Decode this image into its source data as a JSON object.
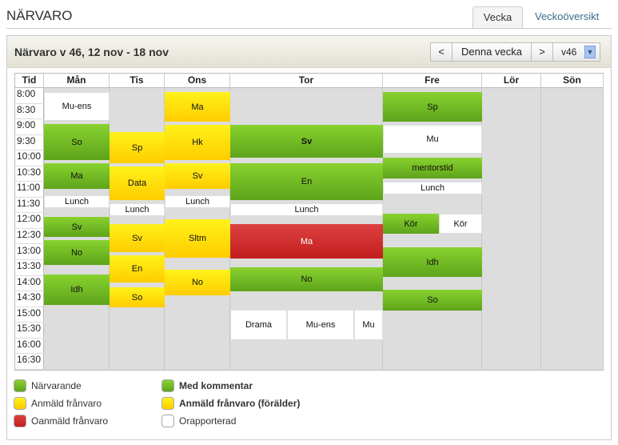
{
  "page": {
    "title": "NÄRVARO",
    "tabs": [
      "Vecka",
      "Veckoöversikt"
    ]
  },
  "panel": {
    "title": "Närvaro v 46, 12 nov - 18 nov",
    "prev": "<",
    "current": "Denna vecka",
    "next": ">",
    "week_select": "v46"
  },
  "colors": {
    "green": "#72bd24",
    "yellow": "#ffe010",
    "red": "#cc2a2a",
    "white": "#ffffff"
  },
  "grid": {
    "time_header": "Tid",
    "times": [
      "8:00",
      "8:30",
      "9:00",
      "9:30",
      "10:00",
      "10:30",
      "11:00",
      "11:30",
      "12:00",
      "12:30",
      "13:00",
      "13:30",
      "14:00",
      "14:30",
      "15:00",
      "15:30",
      "16:00",
      "16:30"
    ],
    "days": [
      {
        "name": "Mån",
        "events": [
          {
            "label": "Mu-ens",
            "status": "white"
          },
          {
            "label": "So",
            "status": "green"
          },
          {
            "label": "Ma",
            "status": "green"
          },
          {
            "label": "Lunch",
            "status": "white"
          },
          {
            "label": "Sv",
            "status": "green"
          },
          {
            "label": "No",
            "status": "green"
          },
          {
            "label": "Idh",
            "status": "green"
          }
        ]
      },
      {
        "name": "Tis",
        "events": [
          {
            "label": "Sp",
            "status": "yellow"
          },
          {
            "label": "Data",
            "status": "yellow"
          },
          {
            "label": "Lunch",
            "status": "white"
          },
          {
            "label": "Sv",
            "status": "yellow"
          },
          {
            "label": "En",
            "status": "yellow"
          },
          {
            "label": "So",
            "status": "yellow"
          }
        ]
      },
      {
        "name": "Ons",
        "events": [
          {
            "label": "Ma",
            "status": "yellow"
          },
          {
            "label": "Hk",
            "status": "yellow"
          },
          {
            "label": "Sv",
            "status": "yellow"
          },
          {
            "label": "Lunch",
            "status": "white"
          },
          {
            "label": "Sltm",
            "status": "yellow"
          },
          {
            "label": "No",
            "status": "yellow"
          }
        ]
      },
      {
        "name": "Tor",
        "events": [
          {
            "label": "Sv",
            "status": "green",
            "bold": true
          },
          {
            "label": "En",
            "status": "green"
          },
          {
            "label": "Lunch",
            "status": "white"
          },
          {
            "label": "Ma",
            "status": "red"
          },
          {
            "label": "No",
            "status": "green"
          },
          {
            "label": "Drama",
            "status": "white"
          },
          {
            "label": "Mu-ens",
            "status": "white"
          },
          {
            "label": "Mu",
            "status": "white"
          }
        ]
      },
      {
        "name": "Fre",
        "events": [
          {
            "label": "Sp",
            "status": "green"
          },
          {
            "label": "Mu",
            "status": "white"
          },
          {
            "label": "mentorstid",
            "status": "green"
          },
          {
            "label": "Lunch",
            "status": "white"
          },
          {
            "label": "Kör",
            "status": "green"
          },
          {
            "label": "Kör",
            "status": "white"
          },
          {
            "label": "Idh",
            "status": "green"
          },
          {
            "label": "So",
            "status": "green"
          }
        ]
      },
      {
        "name": "Lör",
        "events": []
      },
      {
        "name": "Sön",
        "events": []
      }
    ]
  },
  "legend": [
    {
      "label": "Närvarande",
      "color": "green"
    },
    {
      "label": "Anmäld frånvaro",
      "color": "yellow"
    },
    {
      "label": "Oanmäld frånvaro",
      "color": "red"
    },
    {
      "label": "Med kommentar",
      "color": "green",
      "bold": true
    },
    {
      "label": "Anmäld frånvaro (förälder)",
      "color": "yellow",
      "bold": true
    },
    {
      "label": "Orapporterad",
      "color": "white"
    }
  ]
}
